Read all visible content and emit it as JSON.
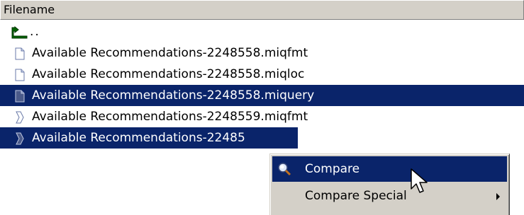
{
  "header": {
    "filename_label": "Filename"
  },
  "files": [
    {
      "name": "..",
      "icon": "up-folder-icon",
      "selected": false
    },
    {
      "name": "Available Recommendations-2248558.miqfmt",
      "icon": "document-icon",
      "selected": false
    },
    {
      "name": "Available Recommendations-2248558.miqloc",
      "icon": "document-icon",
      "selected": false
    },
    {
      "name": "Available Recommendations-2248558.miquery",
      "icon": "document-icon",
      "selected": true
    },
    {
      "name": "Available Recommendations-2248559.miqfmt",
      "icon": "ribbon-document-icon",
      "selected": false
    },
    {
      "name": "Available Recommendations-22485",
      "icon": "ribbon-document-icon",
      "selected": true
    }
  ],
  "context_menu": {
    "items": [
      {
        "label": "Compare",
        "icon": "magnifier-icon",
        "highlighted": true,
        "has_submenu": false
      },
      {
        "label": "Compare Special",
        "icon": "",
        "highlighted": false,
        "has_submenu": true
      }
    ]
  },
  "colors": {
    "selection": "#0a246a",
    "header_bg": "#d4d0c8",
    "menu_bg": "#d4d0c8"
  }
}
